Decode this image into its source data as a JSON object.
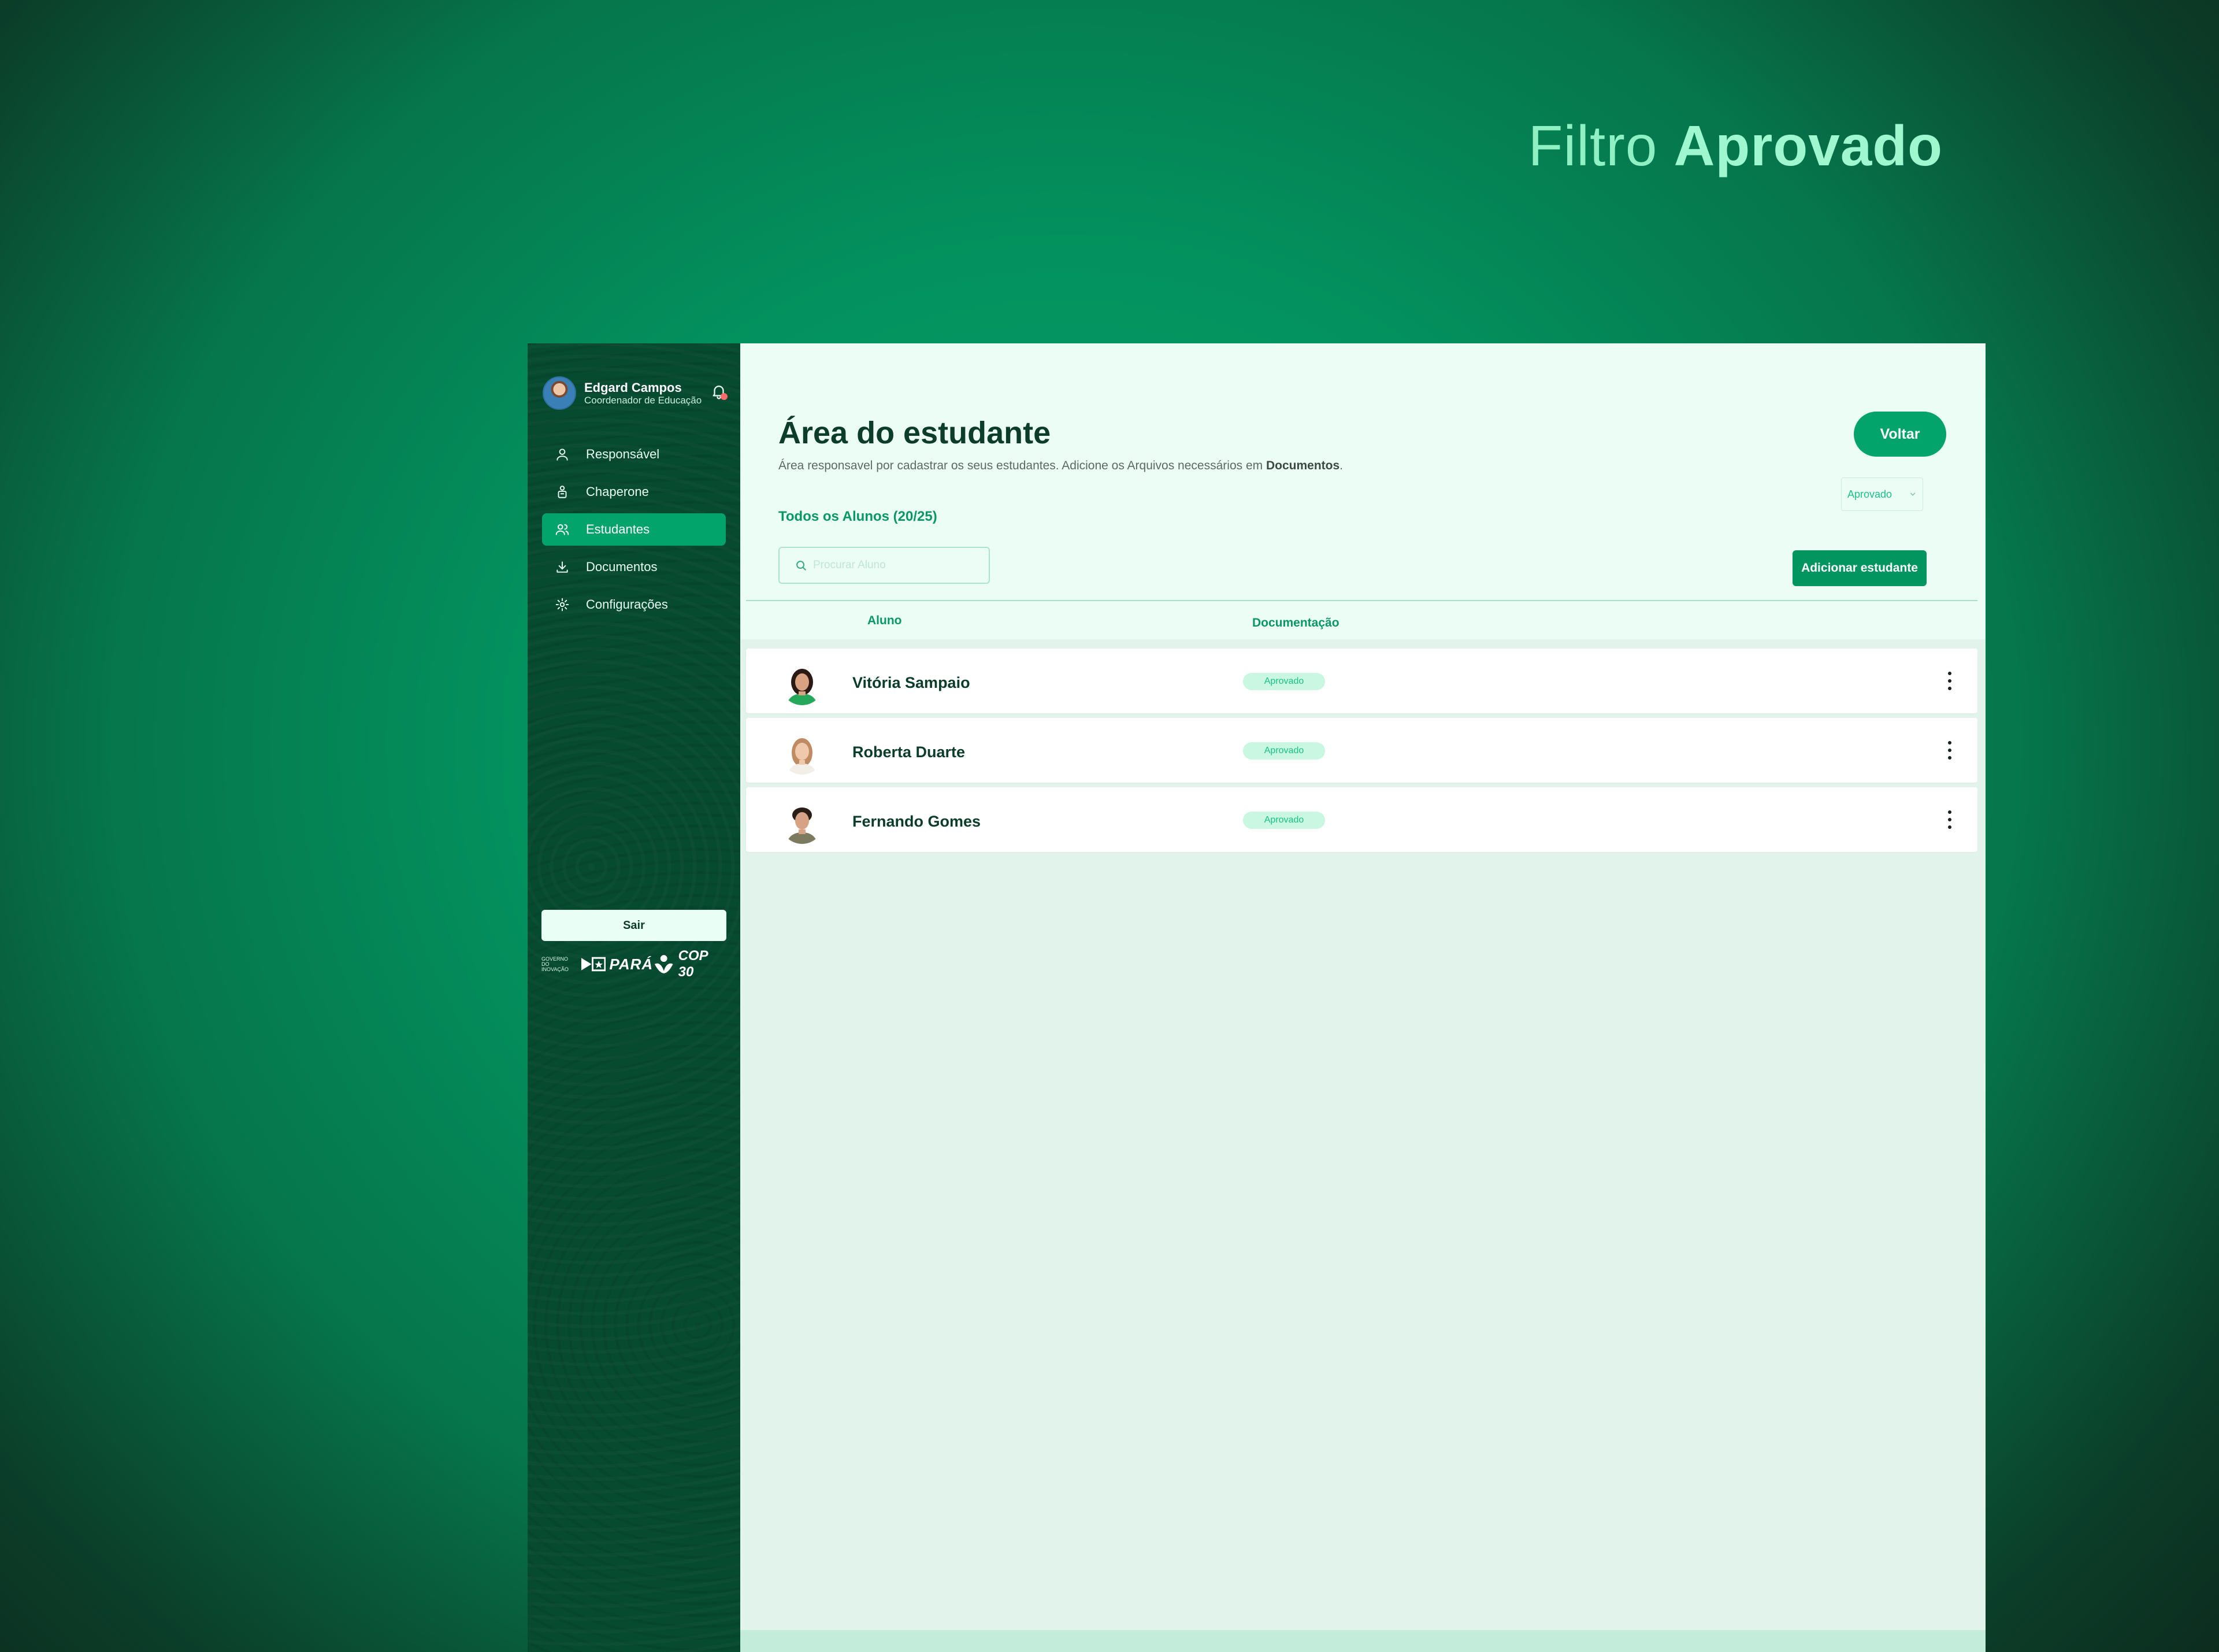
{
  "hero": {
    "prefix": "Filtro",
    "highlight": "Aprovado"
  },
  "user": {
    "name": "Edgard Campos",
    "role": "Coordenador de Educação"
  },
  "nav": [
    {
      "label": "Responsável",
      "icon": "user-icon",
      "active": false
    },
    {
      "label": "Chaperone",
      "icon": "person-badge-icon",
      "active": false
    },
    {
      "label": "Estudantes",
      "icon": "users-icon",
      "active": true
    },
    {
      "label": "Documentos",
      "icon": "download-icon",
      "active": false
    },
    {
      "label": "Configurações",
      "icon": "gear-icon",
      "active": false
    }
  ],
  "sidebar_footer": {
    "logout_label": "Sair",
    "logo_gov_small_top": "GOVERNO DO",
    "logo_gov_small_bottom": "INOVAÇÃO",
    "logo_para": "PARÁ",
    "logo_cop": "COP 30"
  },
  "main": {
    "title": "Área do estudante",
    "subtitle": "Área responsavel por cadastrar os seus estudantes. Adicione os Arquivos necessários em",
    "subtitle_bold": "Documentos",
    "subtitle_end": ".",
    "back_label": "Voltar",
    "filter_value": "Aprovado",
    "count_label": "Todos os Alunos (20/25)",
    "search_placeholder": "Procurar Aluno",
    "add_label": "Adicionar estudante",
    "columns": {
      "student": "Aluno",
      "docs": "Documentação"
    },
    "students": [
      {
        "name": "Vitória Sampaio",
        "status": "Aprovado"
      },
      {
        "name": "Roberta Duarte",
        "status": "Aprovado"
      },
      {
        "name": "Fernando Gomes",
        "status": "Aprovado"
      }
    ]
  },
  "colors": {
    "accent": "#03a46c",
    "sidebar": "#064a2f",
    "badge_bg": "#c9f7e2",
    "badge_text": "#17c285"
  }
}
